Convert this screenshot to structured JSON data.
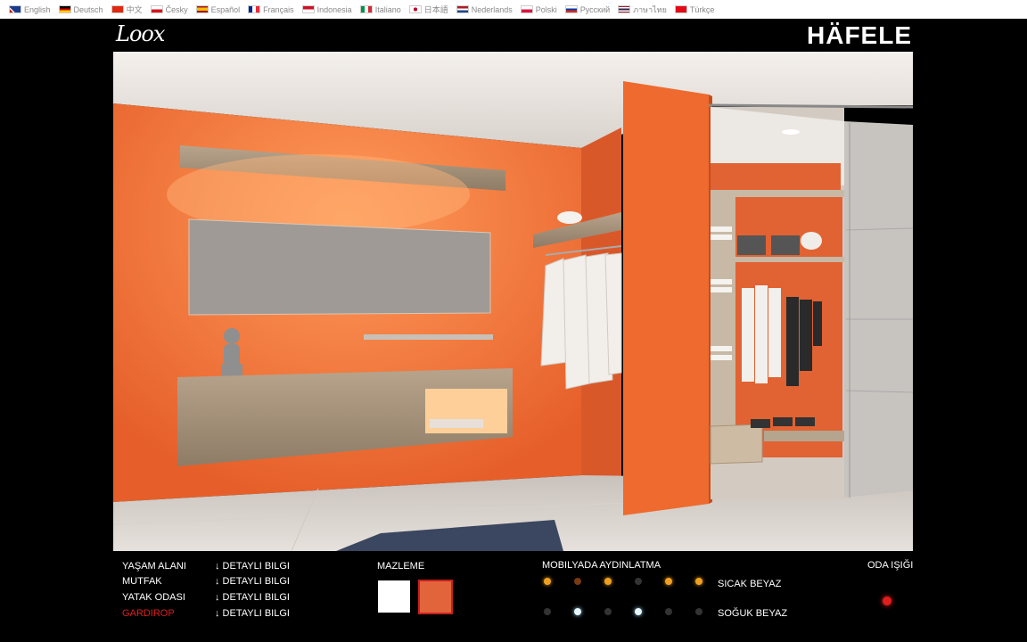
{
  "languages": [
    {
      "label": "English",
      "icon": "uk-flag-icon"
    },
    {
      "label": "Deutsch",
      "icon": "germany-flag-icon"
    },
    {
      "label": "中文",
      "icon": "china-flag-icon"
    },
    {
      "label": "Česky",
      "icon": "czech-flag-icon"
    },
    {
      "label": "Español",
      "icon": "spain-flag-icon"
    },
    {
      "label": "Français",
      "icon": "france-flag-icon"
    },
    {
      "label": "Indonesia",
      "icon": "indonesia-flag-icon"
    },
    {
      "label": "Italiano",
      "icon": "italy-flag-icon"
    },
    {
      "label": "日本語",
      "icon": "japan-flag-icon"
    },
    {
      "label": "Nederlands",
      "icon": "netherlands-flag-icon"
    },
    {
      "label": "Polski",
      "icon": "poland-flag-icon"
    },
    {
      "label": "Русский",
      "icon": "russia-flag-icon"
    },
    {
      "label": "ภาษาไทย",
      "icon": "thailand-flag-icon"
    },
    {
      "label": "Türkçe",
      "icon": "turkey-flag-icon"
    }
  ],
  "logos": {
    "left": "Loox",
    "right": "HÄFELE"
  },
  "rooms": [
    {
      "label": "YAŞAM ALANI",
      "detail": "↓ DETAYLI BILGI"
    },
    {
      "label": "MUTFAK",
      "detail": "↓ DETAYLI BILGI"
    },
    {
      "label": "YATAK ODASI",
      "detail": "↓ DETAYLI BILGI"
    },
    {
      "label": "GARDIROP",
      "detail": "↓ DETAYLI BILGI",
      "active": true
    }
  ],
  "material": {
    "title": "MAZLEME",
    "swatches": [
      {
        "color": "#ffffff"
      },
      {
        "color": "#e2643a",
        "selected": true
      }
    ]
  },
  "lighting": {
    "title": "MOBILYADA AYDINLATMA",
    "warm_label": "SICAK BEYAZ",
    "cool_label": "SOĞUK BEYAZ"
  },
  "room_light": {
    "title": "ODA IŞIĞI"
  },
  "colors": {
    "active": "#e01e1e",
    "orange": "#ee6a2e",
    "warm": "#f0a020",
    "cool": "#e8f6ff",
    "off": "#333333"
  }
}
